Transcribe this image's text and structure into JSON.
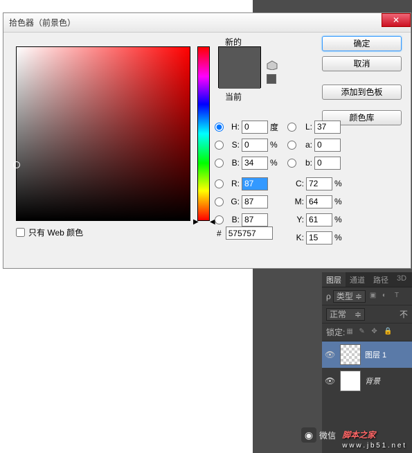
{
  "dialog": {
    "title": "拾色器（前景色）",
    "new_label": "新的",
    "current_label": "当前",
    "web_only": "只有 Web 颜色",
    "hex_prefix": "#",
    "hex_value": "575757"
  },
  "buttons": {
    "ok": "确定",
    "cancel": "取消",
    "add_swatch": "添加到色板",
    "color_lib": "颜色库"
  },
  "fields": {
    "H": {
      "label": "H:",
      "value": "0",
      "unit": "度"
    },
    "S": {
      "label": "S:",
      "value": "0",
      "unit": "%"
    },
    "B": {
      "label": "B:",
      "value": "34",
      "unit": "%"
    },
    "R": {
      "label": "R:",
      "value": "87",
      "unit": ""
    },
    "G": {
      "label": "G:",
      "value": "87",
      "unit": ""
    },
    "Bb": {
      "label": "B:",
      "value": "87",
      "unit": ""
    },
    "L": {
      "label": "L:",
      "value": "37",
      "unit": ""
    },
    "a": {
      "label": "a:",
      "value": "0",
      "unit": ""
    },
    "b": {
      "label": "b:",
      "value": "0",
      "unit": ""
    },
    "C": {
      "label": "C:",
      "value": "72",
      "unit": "%"
    },
    "M": {
      "label": "M:",
      "value": "64",
      "unit": "%"
    },
    "Y": {
      "label": "Y:",
      "value": "61",
      "unit": "%"
    },
    "K": {
      "label": "K:",
      "value": "15",
      "unit": "%"
    }
  },
  "panels": {
    "tabs": [
      "图层",
      "通道",
      "路径",
      "3D"
    ],
    "type_label": "类型",
    "blend_mode": "正常",
    "opacity_label": "不",
    "lock_label": "锁定:",
    "layer1": "图层 1",
    "bg_layer": "背景"
  },
  "watermark": {
    "brand": "脚本之家",
    "site": "w w w . j b 5 1 . n e t",
    "wx": "微信"
  }
}
